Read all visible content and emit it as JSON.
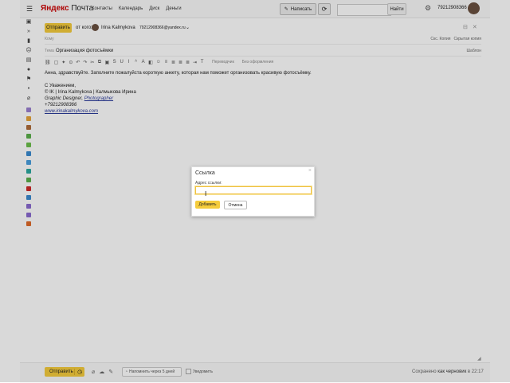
{
  "header": {
    "logo_ya": "Яндекс",
    "logo_mail": "Почта",
    "nav": [
      "Контакты",
      "Календарь",
      "Диск",
      "Деньги"
    ],
    "compose_label": "Написать",
    "search_button": "Найти",
    "phone": "79212908366"
  },
  "compose": {
    "send_label": "Отправить",
    "from_label": "от кого:",
    "from_name": "Irina Kalmykova",
    "from_email": "79212908366@yandex.ru",
    "to_label": "Кому",
    "cc_links": [
      "Скс. Копия",
      "Скрытая копия"
    ],
    "subject_label": "Тема",
    "subject_value": "Организация фотосъёмки",
    "template_label": "Шаблон",
    "toolbar_text": [
      "Переводчик",
      "Без оформления"
    ]
  },
  "body": {
    "greeting": "Анна, здравствуйте. Заполните пожалуйста короткую анкету, которая нам поможет организовать красивую фотосъёмку.",
    "regards": "С Уважением,",
    "sig_line1": "© IK | Irina Kalmykova | Калмыкова Ирина",
    "sig_line2_a": " Graphic Designer, ",
    "sig_line2_b": "Photographer",
    "sig_phone": "+79212908366",
    "sig_site": "www.irinakalmykova.com"
  },
  "footer": {
    "send_label": "Отправить",
    "remind_label": "Напомнить через 5 дней",
    "notify_label": "Уведомить",
    "saved_prefix": "Сохранено",
    "saved_link": "как черновик",
    "saved_time": "в 22:17"
  },
  "dialog": {
    "title": "Ссылка",
    "address_label": "Адрес ссылки:",
    "address_value": "",
    "add_label": "Добавить",
    "cancel_label": "Отмена"
  },
  "colors": {
    "accent": "#f5cc3c",
    "overlay": "rgba(0,0,0,0.15)"
  }
}
